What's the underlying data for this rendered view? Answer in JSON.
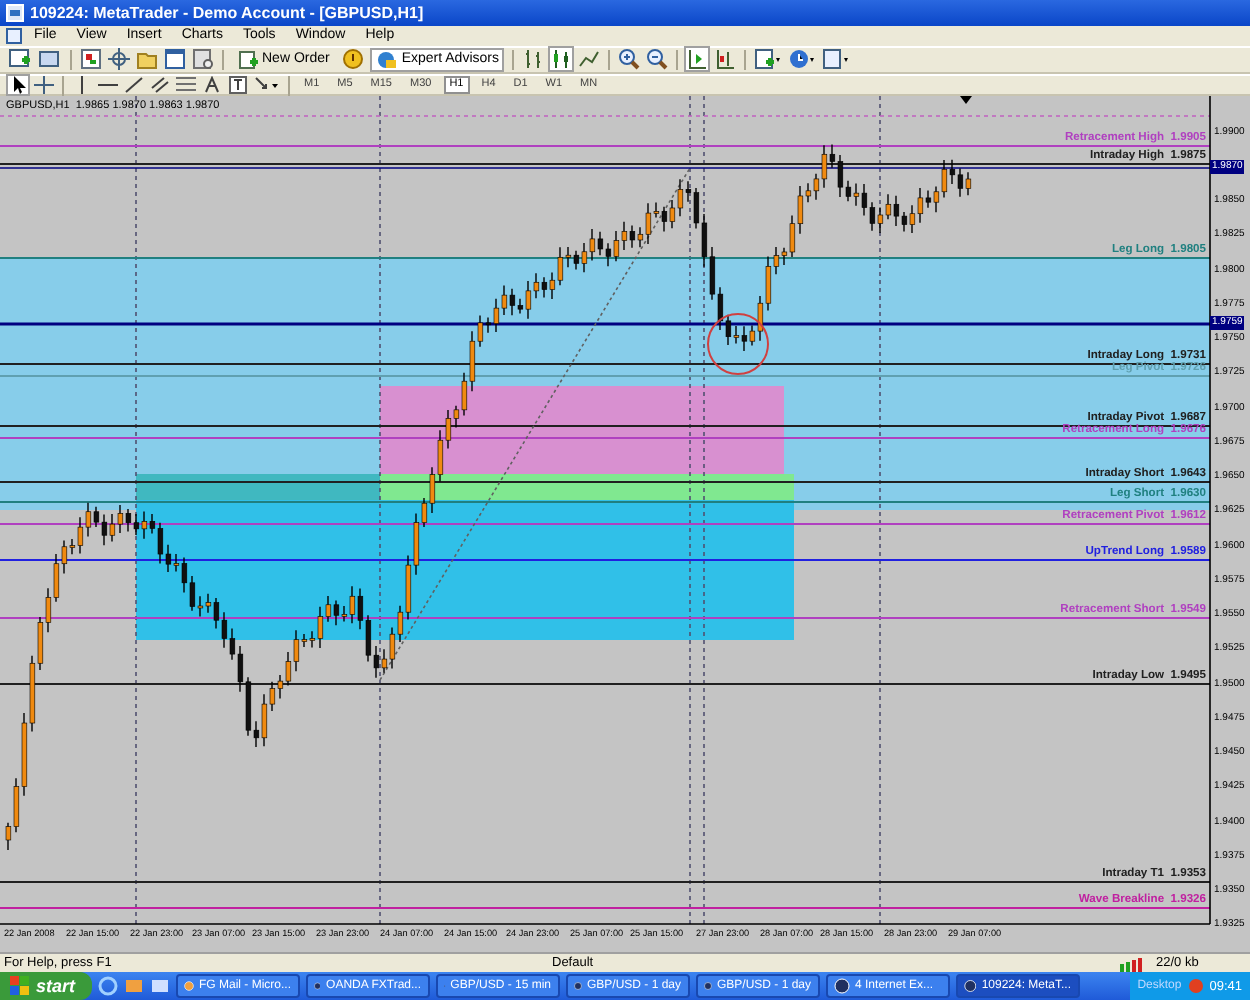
{
  "window": {
    "title": "109224: MetaTrader - Demo Account - [GBPUSD,H1]"
  },
  "menu": [
    "File",
    "View",
    "Insert",
    "Charts",
    "Tools",
    "Window",
    "Help"
  ],
  "toolbar": {
    "buttons": [
      {
        "label": "New Order",
        "on": false
      },
      {
        "label": "Expert Advisors",
        "on": true
      }
    ]
  },
  "timeframes": [
    {
      "label": "M1",
      "selected": false
    },
    {
      "label": "M5",
      "selected": false
    },
    {
      "label": "M15",
      "selected": false
    },
    {
      "label": "M30",
      "selected": false
    },
    {
      "label": "H1",
      "selected": true
    },
    {
      "label": "H4",
      "selected": false
    },
    {
      "label": "D1",
      "selected": false
    },
    {
      "label": "W1",
      "selected": false
    },
    {
      "label": "MN",
      "selected": false
    }
  ],
  "chart": {
    "header": "GBPUSD,H1  1.9865 1.9870 1.9863 1.9870",
    "price_labels": [
      "1.9900",
      "1.9850",
      "1.9825",
      "1.9800",
      "1.9775",
      "1.9750",
      "1.9725",
      "1.9700",
      "1.9675",
      "1.9650",
      "1.9625",
      "1.9600",
      "1.9575",
      "1.9550",
      "1.9525",
      "1.9500",
      "1.9475",
      "1.9450",
      "1.9425",
      "1.9400",
      "1.9375",
      "1.9350",
      "1.9325"
    ],
    "current_prices": [
      "1.9870",
      "1.9759"
    ],
    "levels": [
      {
        "label": "Retracement High  1.9905",
        "color": "#b040c0"
      },
      {
        "label": "Intraday High  1.9875",
        "color": "#202020"
      },
      {
        "label": "Leg Long  1.9805",
        "color": "#208080"
      },
      {
        "label": "Intraday Long  1.9731",
        "color": "#202020"
      },
      {
        "label": "Leg Pivot  1.9726",
        "color": "#60a0b0"
      },
      {
        "label": "Intraday Pivot  1.9687",
        "color": "#202020"
      },
      {
        "label": "Retracement Long  1.9676",
        "color": "#b040c0"
      },
      {
        "label": "Intraday Short  1.9643",
        "color": "#202020"
      },
      {
        "label": "Leg Short  1.9630",
        "color": "#208080"
      },
      {
        "label": "Retracement Pivot  1.9612",
        "color": "#b040c0"
      },
      {
        "label": "UpTrend Long  1.9589",
        "color": "#2020e0"
      },
      {
        "label": "Retracement Short  1.9549",
        "color": "#b040c0"
      },
      {
        "label": "Intraday Low  1.9495",
        "color": "#202020"
      },
      {
        "label": "Intraday T1  1.9353",
        "color": "#202020"
      },
      {
        "label": "Wave Breakline  1.9326",
        "color": "#c020a0"
      }
    ],
    "time_labels": [
      "22 Jan 2008",
      "22 Jan 15:00",
      "22 Jan 23:00",
      "23 Jan 07:00",
      "23 Jan 15:00",
      "23 Jan 23:00",
      "24 Jan 07:00",
      "24 Jan 15:00",
      "24 Jan 23:00",
      "25 Jan 07:00",
      "25 Jan 15:00",
      "27 Jan 23:00",
      "28 Jan 07:00",
      "28 Jan 15:00",
      "28 Jan 23:00",
      "29 Jan 07:00"
    ]
  },
  "status_bar": {
    "help": "For Help, press F1",
    "profile": "Default",
    "traffic": "22/0 kb"
  },
  "taskbar": {
    "start": "start",
    "items": [
      {
        "label": "FG Mail - Micro...",
        "selected": false
      },
      {
        "label": "OANDA FXTrad...",
        "selected": false
      },
      {
        "label": "GBP/USD - 15 min",
        "selected": false
      },
      {
        "label": "GBP/USD - 1 day",
        "selected": false
      },
      {
        "label": "GBP/USD - 1 day",
        "selected": false
      },
      {
        "label": "4 Internet Ex...",
        "selected": false
      },
      {
        "label": "109224: MetaT...",
        "selected": true
      }
    ],
    "desktop": "Desktop",
    "clock": "09:41"
  }
}
